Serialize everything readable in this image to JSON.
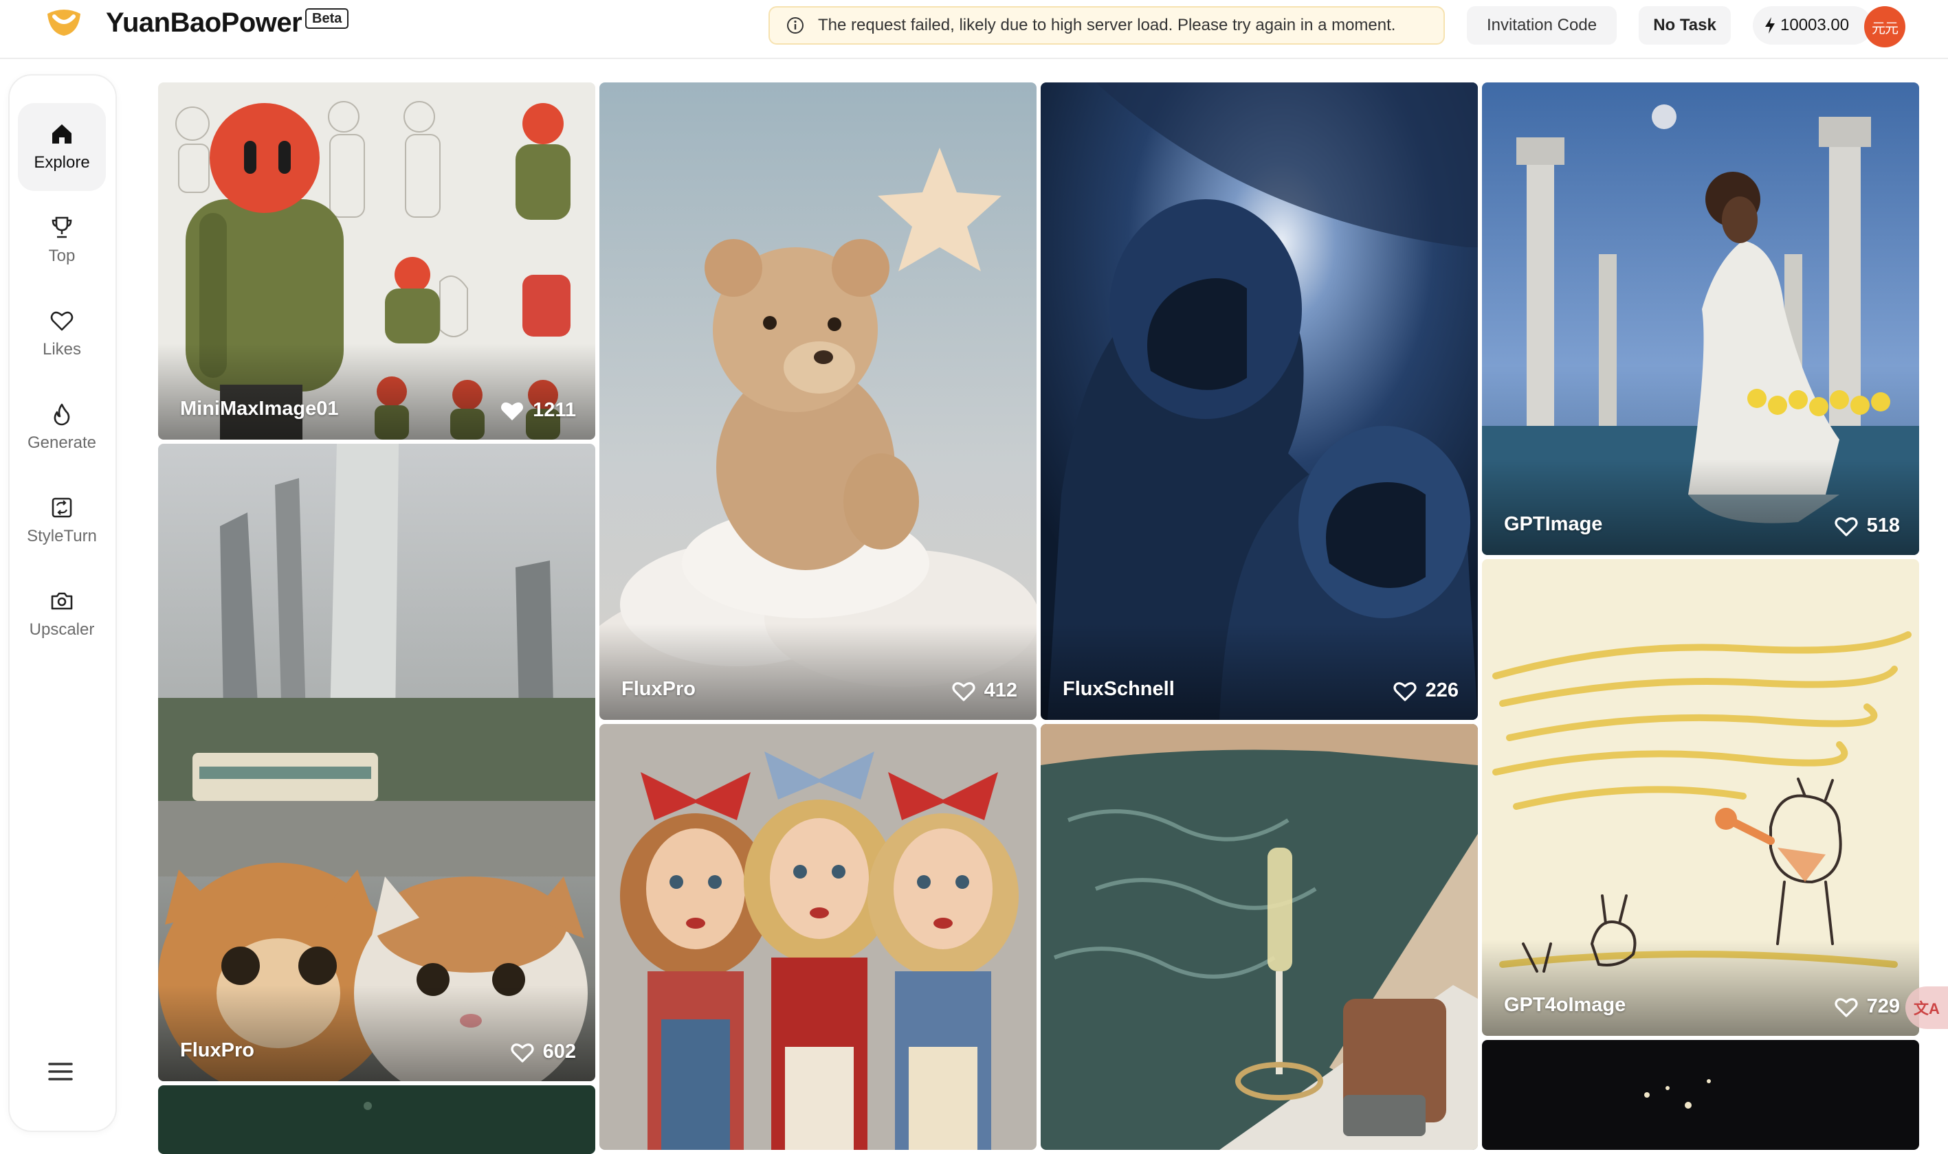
{
  "header": {
    "app_name": "YuanBaoPower",
    "beta_label": "Beta",
    "alert_text": "The request failed, likely due to high server load. Please try again in a moment.",
    "invitation_label": "Invitation Code",
    "task_label": "No Task",
    "credits": "10003.00",
    "avatar_text": "元元",
    "accent_color": "#e8532a"
  },
  "sidebar": {
    "items": [
      {
        "label": "Explore",
        "icon": "home-icon",
        "active": true
      },
      {
        "label": "Top",
        "icon": "trophy-icon",
        "active": false
      },
      {
        "label": "Likes",
        "icon": "heart-icon",
        "active": false
      },
      {
        "label": "Generate",
        "icon": "flame-icon",
        "active": false
      },
      {
        "label": "StyleTurn",
        "icon": "style-swap-icon",
        "active": false
      },
      {
        "label": "Upscaler",
        "icon": "camera-icon",
        "active": false
      }
    ],
    "menu_icon": "hamburger-menu-icon"
  },
  "gallery": {
    "cards": [
      {
        "model": "MiniMaxImage01",
        "likes": "1211",
        "liked": true
      },
      {
        "model": "FluxPro",
        "likes": "602",
        "liked": false
      },
      {
        "model": "FluxPro",
        "likes": "412",
        "liked": false
      },
      {
        "model": "FluxSchnell",
        "likes": "226",
        "liked": false
      },
      {
        "model": "GPTImage",
        "likes": "518",
        "liked": false
      },
      {
        "model": "GPT4oImage",
        "likes": "729",
        "liked": false
      }
    ]
  },
  "translate_fab": "文A"
}
